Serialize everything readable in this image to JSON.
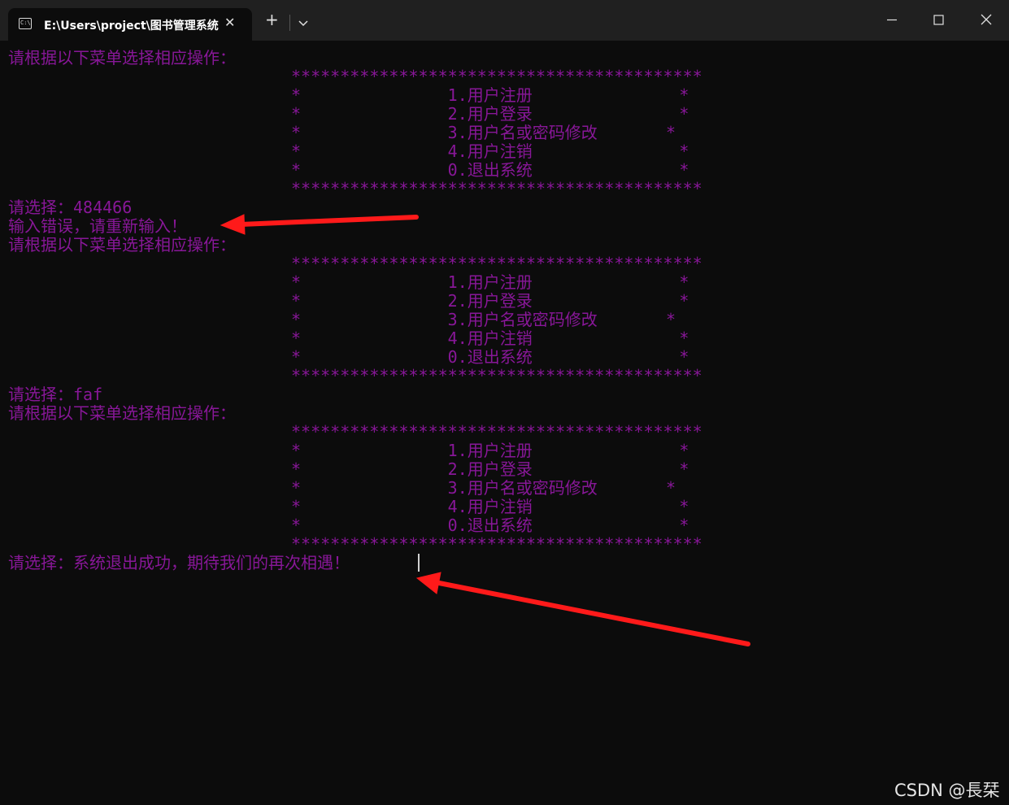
{
  "window": {
    "tab_title": "E:\\Users\\project\\图书管理系统",
    "tab_icon_text": "C:\\",
    "new_tab_label": "+",
    "close_tab_label": "✕"
  },
  "colors": {
    "terminal_text": "#881798",
    "background": "#0c0c0c",
    "titlebar": "#202020",
    "annotation_arrow": "#ff1a1a"
  },
  "terminal": {
    "prompt_menu": "请根据以下菜单选择相应操作：",
    "menu_border": "******************************************",
    "menu_items": [
      "*               1.用户注册               *",
      "*               2.用户登录               *",
      "*               3.用户名或密码修改       *",
      "*               4.用户注销               *",
      "*               0.退出系统               *"
    ],
    "choice_1": "请选择：484466",
    "error_msg": "输入错误，请重新输入！",
    "choice_2": "请选择：faf",
    "choice_3": "请选择：系统退出成功，期待我们的再次相遇！"
  },
  "watermark": "CSDN @長栞"
}
